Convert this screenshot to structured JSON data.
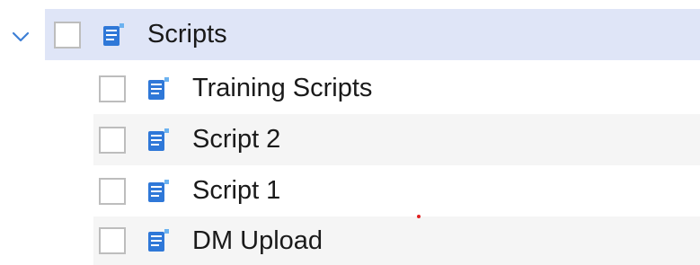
{
  "tree": {
    "parent": {
      "label": "Scripts",
      "expanded": true,
      "checked": false,
      "icon": "script-icon"
    },
    "children": [
      {
        "label": "Training Scripts",
        "checked": false,
        "icon": "script-icon"
      },
      {
        "label": "Script 2",
        "checked": false,
        "icon": "script-icon"
      },
      {
        "label": "Script 1",
        "checked": false,
        "icon": "script-icon"
      },
      {
        "label": "DM Upload",
        "checked": false,
        "icon": "script-icon"
      }
    ]
  },
  "colors": {
    "selected_row": "#dfe5f7",
    "alt_row": "#f5f5f5",
    "icon_blue": "#2f78d8",
    "chevron": "#3d7fd6"
  }
}
